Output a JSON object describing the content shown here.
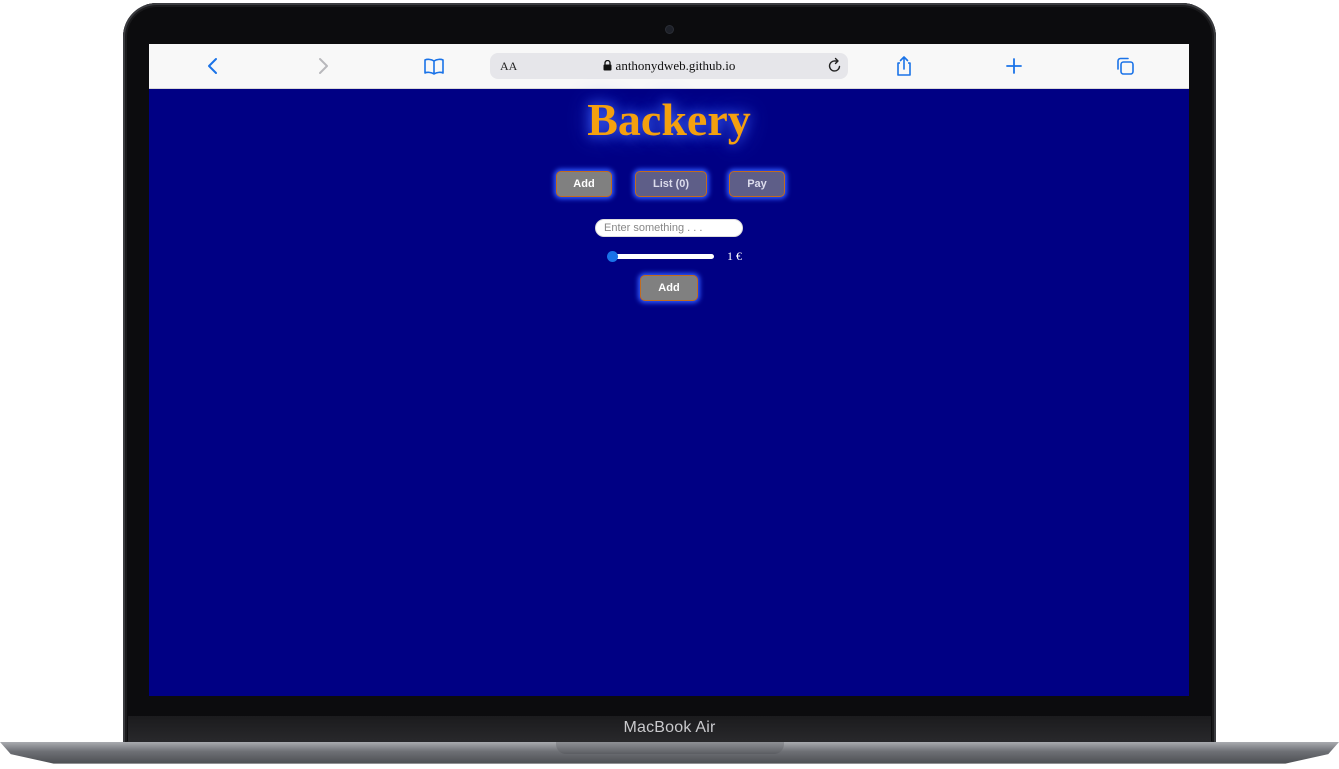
{
  "device": {
    "brand_label": "MacBook Air"
  },
  "browser": {
    "reader_label": "AA",
    "url": "anthonydweb.github.io",
    "icons": [
      "chevron-left-icon",
      "chevron-right-icon",
      "book-icon",
      "lock-icon",
      "reload-icon",
      "share-icon",
      "plus-icon",
      "tabs-icon"
    ],
    "accent_color": "#1a73e8"
  },
  "app": {
    "title": "Backery",
    "title_color": "#f4a00f",
    "background_color": "#000084",
    "nav": {
      "add_label": "Add",
      "list_label": "List (0)",
      "pay_label": "Pay"
    },
    "form": {
      "input_placeholder": "Enter something . . .",
      "input_value": "",
      "price_slider_level": 0,
      "price_label": "1 €",
      "submit_label": "Add"
    }
  }
}
